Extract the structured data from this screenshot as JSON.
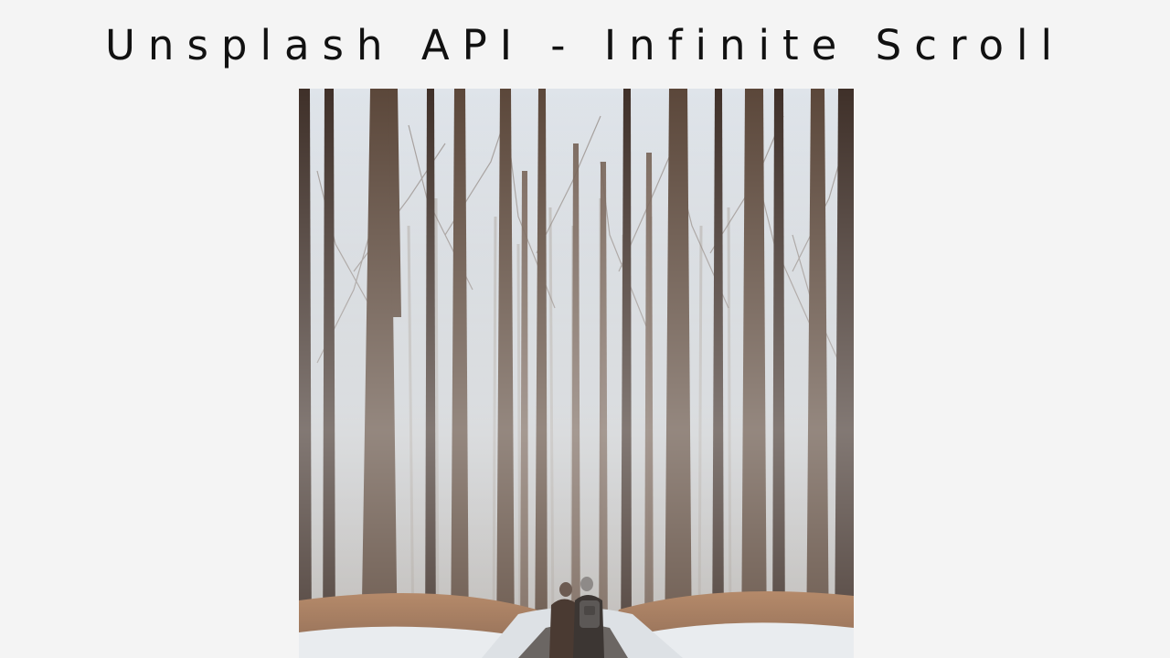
{
  "header": {
    "title": "Unsplash API - Infinite Scroll"
  },
  "gallery": {
    "images": [
      {
        "subject": "two people walking on a snowy path through a bare winter forest"
      }
    ]
  },
  "colors": {
    "background": "#f4f4f4",
    "title_text": "#111111"
  }
}
